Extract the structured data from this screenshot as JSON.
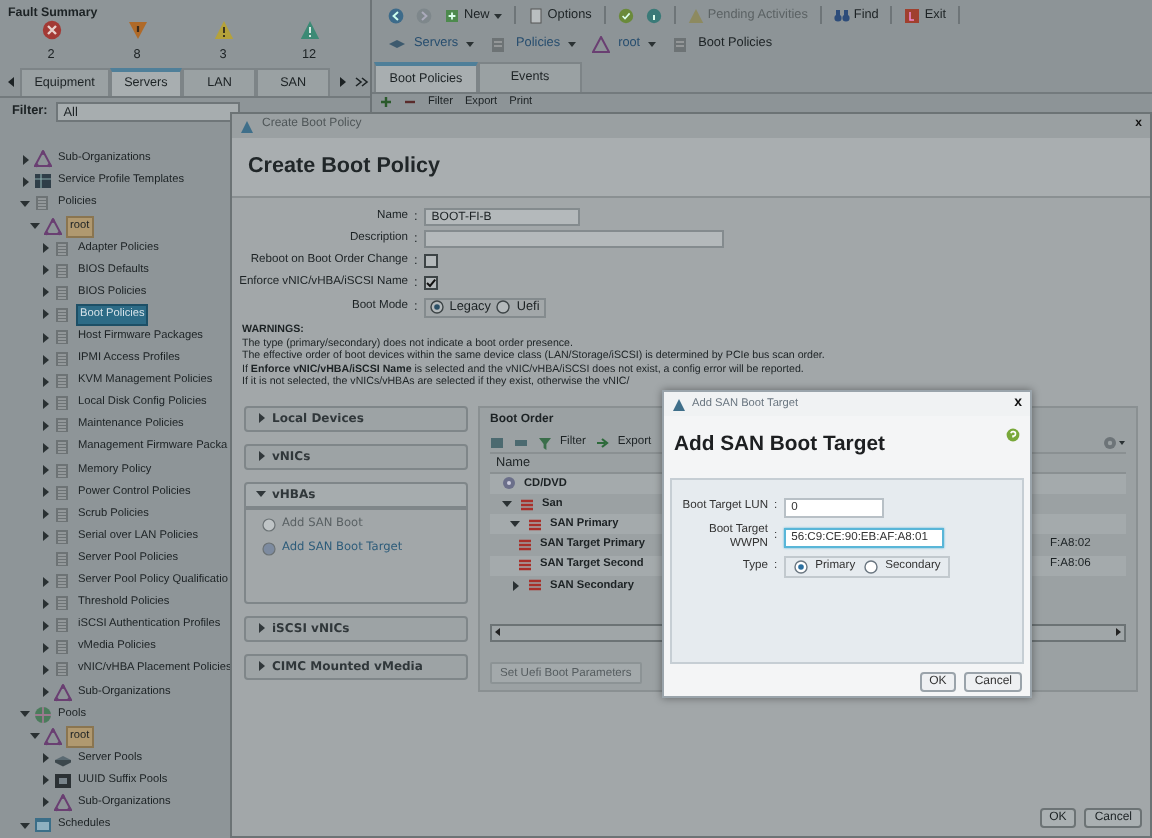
{
  "fault_summary": {
    "title": "Fault Summary",
    "faults": [
      {
        "kind": "critical",
        "count": "2"
      },
      {
        "kind": "major",
        "count": "8"
      },
      {
        "kind": "minor",
        "count": "3"
      },
      {
        "kind": "warning",
        "count": "12"
      }
    ]
  },
  "nav_tabs": [
    {
      "label": "Equipment",
      "selected": false
    },
    {
      "label": "Servers",
      "selected": true
    },
    {
      "label": "LAN",
      "selected": false
    },
    {
      "label": "SAN",
      "selected": false
    }
  ],
  "filter": {
    "label": "Filter:",
    "value": "All"
  },
  "tree": [
    {
      "label": "Sub-Organizations",
      "kind": "org",
      "expanded": false,
      "selected": false
    },
    {
      "label": "Service Profile Templates",
      "kind": "template",
      "expanded": false,
      "selected": false
    },
    {
      "label": "Policies",
      "kind": "policy",
      "expanded": true,
      "selected": false,
      "children": [
        {
          "label": "root",
          "kind": "root",
          "expanded": true,
          "selected": false,
          "children": [
            {
              "label": "Adapter Policies",
              "kind": "policy",
              "expanded": false,
              "selected": false
            },
            {
              "label": "BIOS Defaults",
              "kind": "policy",
              "expanded": false,
              "selected": false
            },
            {
              "label": "BIOS Policies",
              "kind": "policy",
              "expanded": false,
              "selected": false
            },
            {
              "label": "Boot Policies",
              "kind": "policy",
              "expanded": false,
              "selected": true
            },
            {
              "label": "Host Firmware Packages",
              "kind": "policy",
              "expanded": false,
              "selected": false
            },
            {
              "label": "IPMI Access Profiles",
              "kind": "policy",
              "expanded": false,
              "selected": false
            },
            {
              "label": "KVM Management Policies",
              "kind": "policy",
              "expanded": false,
              "selected": false
            },
            {
              "label": "Local Disk Config Policies",
              "kind": "policy",
              "expanded": false,
              "selected": false
            },
            {
              "label": "Maintenance Policies",
              "kind": "policy",
              "expanded": false,
              "selected": false
            },
            {
              "label": "Management Firmware Packa",
              "kind": "policy",
              "expanded": false,
              "selected": false
            },
            {
              "label": "Memory Policy",
              "kind": "policy",
              "expanded": false,
              "selected": false
            },
            {
              "label": "Power Control Policies",
              "kind": "policy",
              "expanded": false,
              "selected": false
            },
            {
              "label": "Scrub Policies",
              "kind": "policy",
              "expanded": false,
              "selected": false
            },
            {
              "label": "Serial over LAN Policies",
              "kind": "policy",
              "expanded": false,
              "selected": false
            },
            {
              "label": "Server Pool Policies",
              "kind": "policy",
              "selected": false
            },
            {
              "label": "Server Pool Policy Qualificatio",
              "kind": "policy",
              "expanded": false,
              "selected": false
            },
            {
              "label": "Threshold Policies",
              "kind": "policy",
              "expanded": false,
              "selected": false
            },
            {
              "label": "iSCSI Authentication Profiles",
              "kind": "policy",
              "expanded": false,
              "selected": false
            },
            {
              "label": "vMedia Policies",
              "kind": "policy",
              "expanded": false,
              "selected": false
            },
            {
              "label": "vNIC/vHBA Placement Policies",
              "kind": "policy",
              "expanded": false,
              "selected": false
            },
            {
              "label": "Sub-Organizations",
              "kind": "org",
              "expanded": false,
              "selected": false
            }
          ]
        }
      ]
    },
    {
      "label": "Pools",
      "kind": "globe",
      "expanded": true,
      "selected": false,
      "children": [
        {
          "label": "root",
          "kind": "root",
          "expanded": true,
          "selected": false,
          "children": [
            {
              "label": "Server Pools",
              "kind": "server",
              "expanded": false,
              "selected": false
            },
            {
              "label": "UUID Suffix Pools",
              "kind": "uuid",
              "expanded": false,
              "selected": false
            },
            {
              "label": "Sub-Organizations",
              "kind": "org",
              "expanded": false,
              "selected": false
            }
          ]
        }
      ]
    },
    {
      "label": "Schedules",
      "kind": "schedule",
      "expanded": true,
      "selected": false
    }
  ],
  "toolbar": [
    {
      "label": "New",
      "kind": "new",
      "disabled": false
    },
    {
      "label": "Options",
      "kind": "options",
      "disabled": false
    },
    {
      "label": "Pending Activities",
      "kind": "pending",
      "disabled": true
    },
    {
      "label": "Find",
      "kind": "find",
      "disabled": false
    },
    {
      "label": "Exit",
      "kind": "exit",
      "disabled": false
    }
  ],
  "breadcrumb": [
    {
      "label": "Servers",
      "kind": "menu"
    },
    {
      "label": "Policies",
      "kind": "menu"
    },
    {
      "label": "root",
      "kind": "menu"
    },
    {
      "label": "Boot Policies",
      "kind": "page"
    }
  ],
  "content_tabs": [
    {
      "label": "Boot Policies",
      "selected": true
    },
    {
      "label": "Events",
      "selected": false
    }
  ],
  "table_toolbar": [
    "Filter",
    "Export",
    "Print"
  ],
  "create_dialog": {
    "title": "Create Boot Policy",
    "close": "x",
    "heading": "Create Boot Policy",
    "fields": [
      {
        "kind": "text",
        "label": "Name",
        "value": "BOOT-FI-B"
      },
      {
        "kind": "text",
        "label": "Description"
      },
      {
        "kind": "checkbox",
        "label": "Reboot on Boot Order Change",
        "checked": false
      },
      {
        "kind": "checkbox",
        "label": "Enforce vNIC/vHBA/iSCSI Name",
        "checked": true
      },
      {
        "kind": "radio",
        "label": "Boot Mode",
        "options": [
          {
            "label": "Legacy",
            "selected": true
          },
          {
            "label": "Uefi",
            "selected": false
          }
        ]
      }
    ],
    "separator": ":",
    "warnings": {
      "title": "WARNINGS:",
      "lines": [
        "The type (primary/secondary) does not indicate a boot order presence.",
        "The effective order of boot devices within the same device class (LAN/Storage/iSCSI) is determined by PCIe bus scan order.",
        "If **Enforce vNIC/vHBA/iSCSI Name** is selected and the vNIC/vHBA/iSCSI does not exist, a config error will be reported.",
        "If it is not selected, the vNICs/vHBAs are selected if they exist, otherwise the vNIC/"
      ]
    },
    "sections": [
      {
        "label": "Local Devices",
        "expanded": false
      },
      {
        "label": "vNICs",
        "expanded": false
      },
      {
        "label": "vHBAs",
        "expanded": true,
        "actions": [
          {
            "label": "Add SAN Boot",
            "disabled": true
          },
          {
            "label": "Add SAN Boot Target",
            "disabled": false
          }
        ]
      },
      {
        "label": "iSCSI vNICs",
        "expanded": false
      },
      {
        "label": "CIMC Mounted vMedia",
        "expanded": false
      }
    ],
    "boot_order": {
      "title": "Boot Order",
      "toolbar": [
        "Filter",
        "Export"
      ],
      "columns": [
        "Name"
      ],
      "rows": [
        {
          "name": "CD/DVD",
          "kind": "disc"
        },
        {
          "name": "San",
          "kind": "san",
          "expanded": true,
          "children": [
            {
              "name": "SAN Primary",
              "kind": "san",
              "expanded": true,
              "children": [
                {
                  "name": "SAN Target Primary",
                  "kind": "san",
                  "column_2": "F:A8:02"
                },
                {
                  "name": "SAN Target Second",
                  "kind": "san",
                  "column_2": "F:A8:06"
                }
              ]
            },
            {
              "name": "SAN Secondary",
              "kind": "san",
              "expanded": false
            }
          ]
        }
      ]
    },
    "uefi_button": {
      "label": "Set Uefi Boot Parameters",
      "disabled": true
    },
    "buttons": [
      "OK",
      "Cancel"
    ]
  },
  "san_dialog": {
    "title": "Add SAN Boot Target",
    "close": "x",
    "heading": "Add SAN Boot Target",
    "separator": ":",
    "lun": {
      "label": "Boot Target LUN",
      "value": "0",
      "focused": false
    },
    "wwpn": {
      "label": "Boot Target WWPN",
      "value": "56:C9:CE:90:EB:AF:A8:01",
      "focused": true
    },
    "type": {
      "label": "Type",
      "options": [
        {
          "label": "Primary",
          "selected": true
        },
        {
          "label": "Secondary",
          "selected": false
        }
      ]
    },
    "buttons": [
      "OK",
      "Cancel"
    ]
  }
}
